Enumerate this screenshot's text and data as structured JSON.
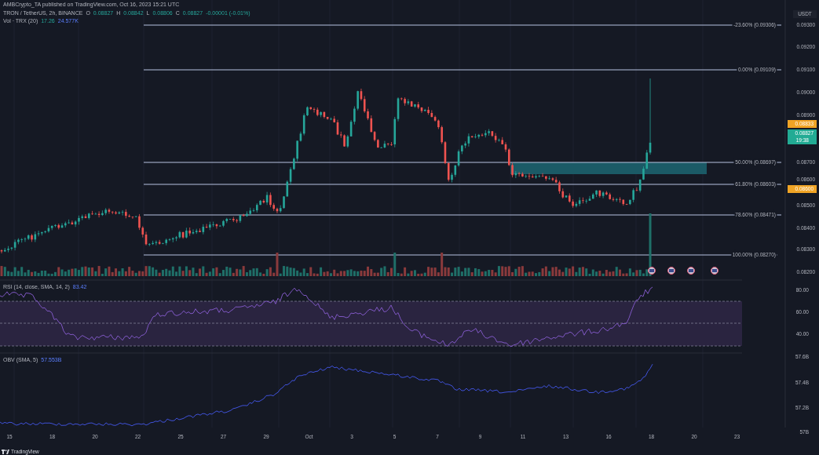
{
  "header": {
    "publisher": "AMBCrypto_TA published on TradingView.com, Oct 16, 2023 15:21 UTC"
  },
  "legend": {
    "symbol": "TRON / TetherUS, 2h, BINANCE",
    "ohlc": [
      {
        "label": "O",
        "value": "0.08827"
      },
      {
        "label": "H",
        "value": "0.08842"
      },
      {
        "label": "L",
        "value": "0.08806"
      },
      {
        "label": "C",
        "value": "0.08827"
      }
    ],
    "change": "-0.00001 (-0.01%)"
  },
  "volume_legend": {
    "name": "Vol · TRX (20)",
    "value": "17.26",
    "ma": "24.577K"
  },
  "price_axis": {
    "currency": "USDT",
    "ticks": [
      "0.09300",
      "0.09200",
      "0.09100",
      "0.09000",
      "0.08900",
      "0.08700",
      "0.08600",
      "0.08500",
      "0.08400",
      "0.08300",
      "0.08200"
    ]
  },
  "badges": [
    {
      "kind": "alert",
      "text": "0.08833"
    },
    {
      "kind": "last",
      "text": "0.08827",
      "countdown": "19:38"
    },
    {
      "kind": "alert",
      "text": "0.08600"
    }
  ],
  "fib_levels": [
    {
      "label": "-23.60% (0.09306)"
    },
    {
      "label": "0.00% (0.09109)"
    },
    {
      "label": "50.00% (0.08697)"
    },
    {
      "label": "61.80% (0.08603)"
    },
    {
      "label": "78.60% (0.08471)"
    },
    {
      "label": "100.00% (0.08270)"
    }
  ],
  "rsi": {
    "title": "RSI (14, close, SMA, 14, 2)",
    "value": "83.42",
    "ticks": [
      "80.00",
      "60.00",
      "40.00"
    ]
  },
  "obv": {
    "title": "OBV (SMA, 5)",
    "value": "57.553B",
    "ticks": [
      "57.6B",
      "57.4B",
      "57.2B",
      "57B"
    ]
  },
  "time_axis": [
    "15",
    "18",
    "20",
    "22",
    "25",
    "27",
    "29",
    "Oct",
    "3",
    "5",
    "7",
    "9",
    "11",
    "13",
    "16",
    "18",
    "20",
    "23"
  ],
  "footer": {
    "brand": "TradingView"
  }
}
